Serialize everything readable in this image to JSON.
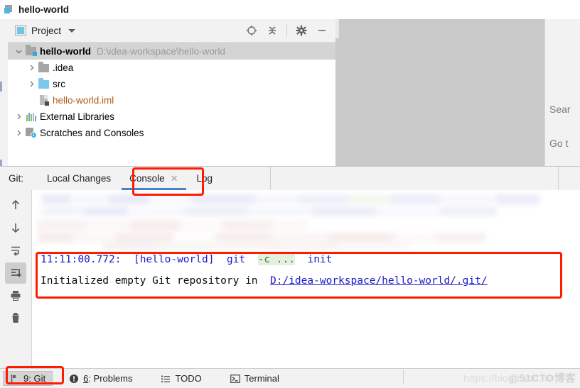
{
  "window": {
    "title": "hello-world"
  },
  "project_panel": {
    "toolbar": {
      "label": "Project",
      "dropdown_icon": "chevron-down-icon",
      "actions": [
        {
          "name": "locate-icon",
          "tooltip": "Select Opened File"
        },
        {
          "name": "collapse-all-icon",
          "tooltip": "Collapse All"
        },
        {
          "name": "gear-icon",
          "tooltip": "Settings"
        },
        {
          "name": "minimize-icon",
          "tooltip": "Hide"
        }
      ]
    },
    "tree": [
      {
        "label": "hello-world",
        "path": "D:\\idea-workspace\\hello-world",
        "icon": "module-folder-icon",
        "expanded": true,
        "indent": 0,
        "bold": true
      },
      {
        "label": ".idea",
        "path": "",
        "icon": "folder-icon",
        "expanded": false,
        "indent": 1,
        "bold": false
      },
      {
        "label": "src",
        "path": "",
        "icon": "source-folder-icon",
        "expanded": false,
        "indent": 1,
        "bold": false
      },
      {
        "label": "hello-world.iml",
        "path": "",
        "icon": "iml-file-icon",
        "expanded": null,
        "indent": 1,
        "bold": false
      },
      {
        "label": "External Libraries",
        "path": "",
        "icon": "libraries-icon",
        "expanded": false,
        "indent": 0,
        "bold": false
      },
      {
        "label": "Scratches and Consoles",
        "path": "",
        "icon": "scratches-icon",
        "expanded": false,
        "indent": 0,
        "bold": false
      }
    ]
  },
  "editor_area": {
    "hints": [
      {
        "text": "Sear"
      },
      {
        "text": "Go t"
      }
    ]
  },
  "git_window": {
    "prefix_label": "Git:",
    "tabs": [
      {
        "label": "Local Changes",
        "active": false,
        "closable": false
      },
      {
        "label": "Console",
        "active": true,
        "closable": true,
        "close_icon": "close-icon"
      },
      {
        "label": "Log",
        "active": false,
        "closable": false
      }
    ],
    "toolbar_buttons": [
      {
        "name": "previous-occurrence-icon",
        "label": "Up",
        "selected": false
      },
      {
        "name": "next-occurrence-icon",
        "label": "Down",
        "selected": false
      },
      {
        "name": "soft-wrap-icon",
        "label": "Soft-Wrap",
        "selected": false
      },
      {
        "name": "scroll-to-end-icon",
        "label": "Scroll to End",
        "selected": true
      },
      {
        "name": "print-icon",
        "label": "Print",
        "selected": false
      },
      {
        "name": "clear-all-icon",
        "label": "Clear All",
        "selected": false
      }
    ],
    "console": {
      "line1": {
        "timestamp": "11:11:00.772:",
        "project": "[hello-world]",
        "command": "git",
        "highlighted": "-c ...",
        "subcommand": "init"
      },
      "line2": {
        "message": "Initialized empty Git repository in",
        "link": "D:/idea-workspace/hello-world/.git/"
      }
    }
  },
  "status_bar": {
    "items": [
      {
        "name": "git-status-button",
        "icon": "git-branch-icon",
        "mnemonic": "9",
        "label": ": Git",
        "active": true
      },
      {
        "name": "problems-status-button",
        "icon": "error-circle-icon",
        "mnemonic": "6",
        "label": ": Problems",
        "active": false
      },
      {
        "name": "todo-status-button",
        "icon": "list-icon",
        "mnemonic": "",
        "label": "TODO",
        "active": false
      },
      {
        "name": "terminal-status-button",
        "icon": "terminal-icon",
        "mnemonic": "",
        "label": "Terminal",
        "active": false
      }
    ],
    "watermark": {
      "url": "https://blog.csdn.ne",
      "brand": "@51CTO博客"
    }
  },
  "annotations": {
    "accent_red": "#ff1a00",
    "accent_blue": "#4087c9",
    "boxes": [
      {
        "name": "console-tab-highlight"
      },
      {
        "name": "git-output-highlight"
      },
      {
        "name": "git-status-highlight"
      }
    ]
  }
}
